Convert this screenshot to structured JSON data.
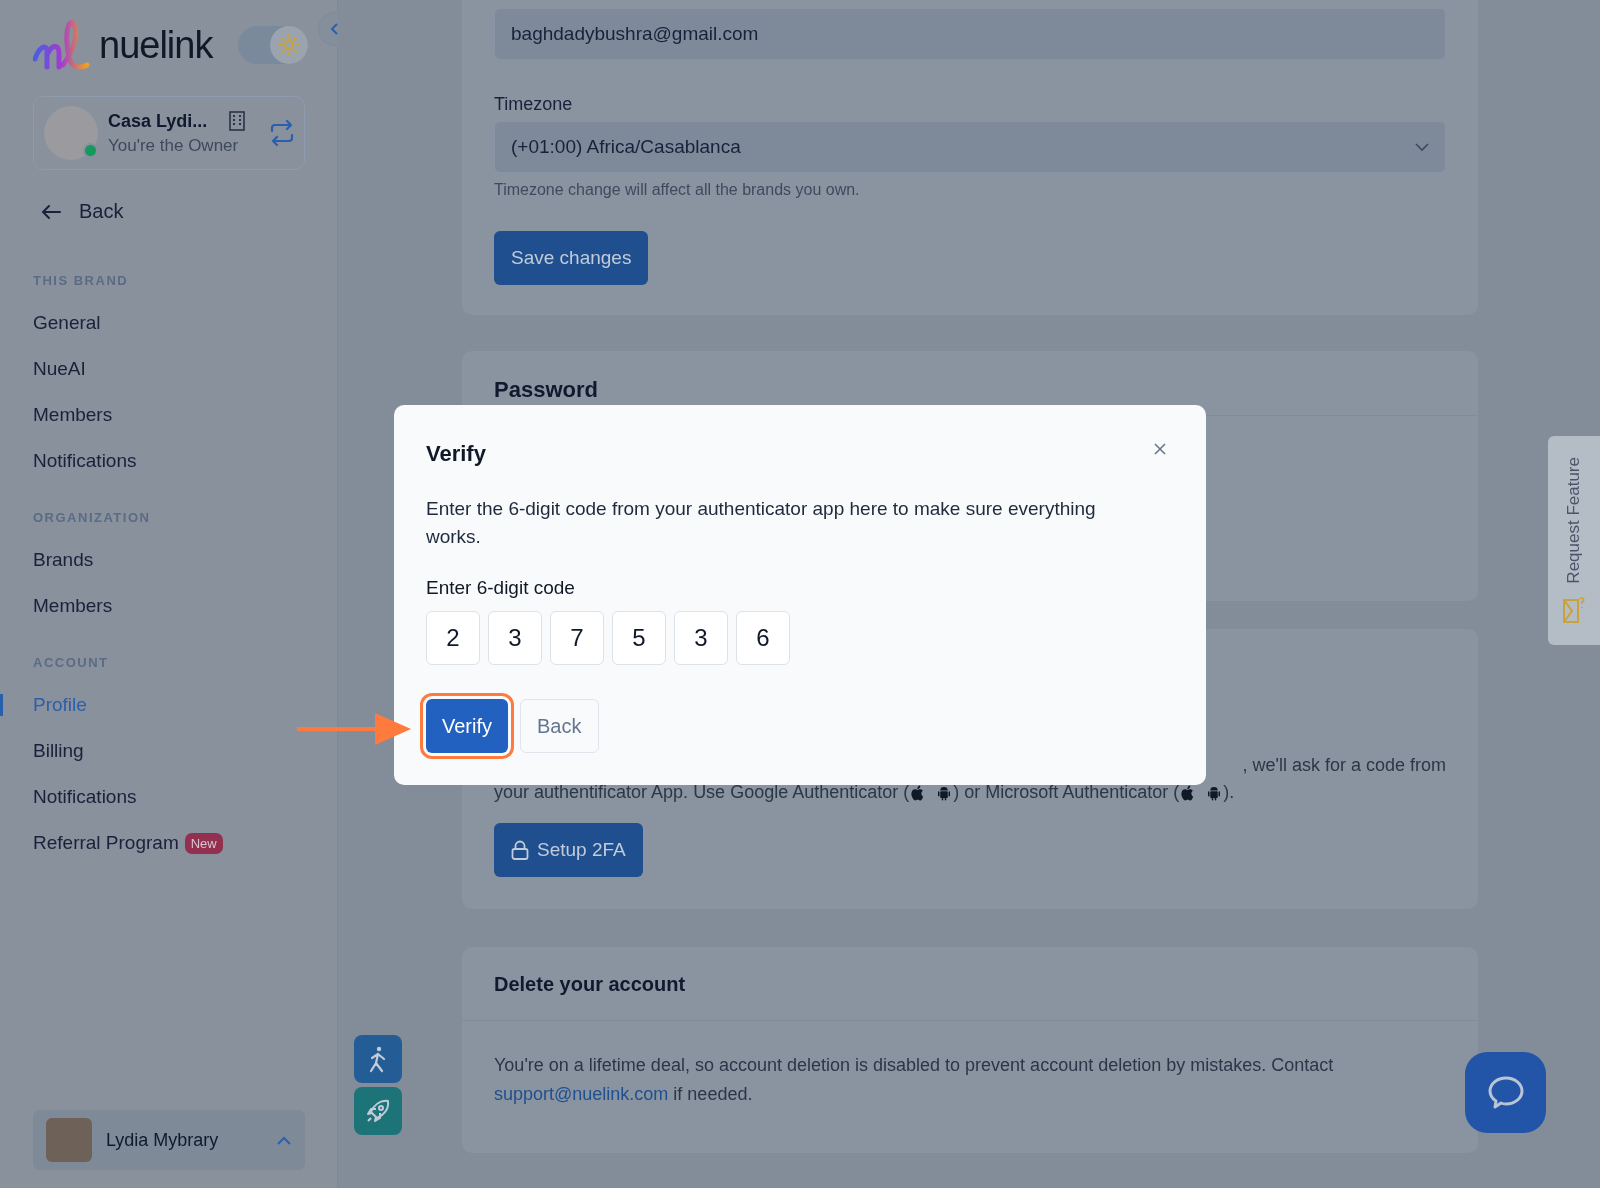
{
  "sidebar": {
    "brand": "nuelink",
    "theme_toggle": {
      "on": true
    },
    "workspace": {
      "name": "Casa Lydi...",
      "role": "You're the Owner",
      "online": true
    },
    "back": "Back",
    "sections": [
      {
        "heading": "THIS BRAND",
        "items": [
          {
            "label": "General",
            "selected": false
          },
          {
            "label": "NueAI",
            "selected": false
          },
          {
            "label": "Members",
            "selected": false
          },
          {
            "label": "Notifications",
            "selected": false
          }
        ]
      },
      {
        "heading": "ORGANIZATION",
        "items": [
          {
            "label": "Brands",
            "selected": false
          },
          {
            "label": "Members",
            "selected": false
          }
        ]
      },
      {
        "heading": "ACCOUNT",
        "items": [
          {
            "label": "Profile",
            "selected": true
          },
          {
            "label": "Billing",
            "selected": false
          },
          {
            "label": "Notifications",
            "selected": false
          },
          {
            "label": "Referral Program",
            "selected": false,
            "badge": "New"
          }
        ]
      }
    ],
    "user": {
      "name": "Lydia Mybrary"
    }
  },
  "profile": {
    "email": "baghdadybushra@gmail.com",
    "timezone_label": "Timezone",
    "timezone": "(+01:00) Africa/Casablanca",
    "timezone_hint": "Timezone change will affect all the brands you own.",
    "save": "Save changes"
  },
  "password": {
    "title": "Password"
  },
  "two_factor": {
    "line_1": ", we'll ask for a code from",
    "line_2_parts": [
      "your authentificator App. Use Google Authenticator (",
      ") or Microsoft Authenticator (",
      "). "
    ],
    "button": "Setup 2FA"
  },
  "delete_account": {
    "title": "Delete your account",
    "text": "You're on a lifetime deal, so account deletion is disabled to prevent account deletion by mistakes. Contact",
    "link": "support@nuelink.com",
    "text_after": "if needed."
  },
  "request_feature": "Request Feature",
  "modal": {
    "title": "Verify",
    "description": "Enter the 6-digit code from your authenticator app here to make sure everything works.",
    "code_label": "Enter 6-digit code",
    "digits": [
      "2",
      "3",
      "7",
      "5",
      "3",
      "6"
    ],
    "buttons": [
      {
        "label": "Verify",
        "kind": "primary",
        "highlighted": true
      },
      {
        "label": "Back",
        "kind": "secondary",
        "highlighted": false
      }
    ]
  }
}
